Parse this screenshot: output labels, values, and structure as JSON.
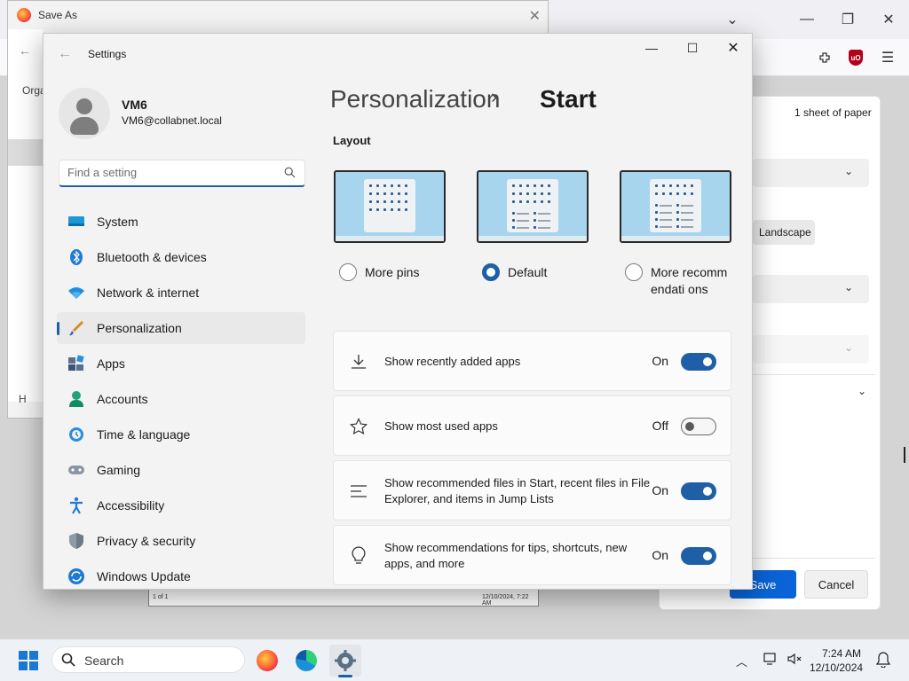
{
  "browser": {
    "save_as_title": "Save As",
    "save_as_org": "Orga",
    "save_as_h": "H"
  },
  "print": {
    "sheets": "1 sheet of paper",
    "landscape": "Landscape",
    "save": "Save",
    "cancel": "Cancel",
    "preview_left": "1 of 1",
    "preview_right": "12/10/2024, 7:22 AM"
  },
  "settings": {
    "app_title": "Settings",
    "user_name": "VM6",
    "user_email": "VM6@collabnet.local",
    "search_placeholder": "Find a setting",
    "nav": [
      {
        "label": "System",
        "icon": "system-icon"
      },
      {
        "label": "Bluetooth & devices",
        "icon": "bluetooth-icon"
      },
      {
        "label": "Network & internet",
        "icon": "wifi-icon"
      },
      {
        "label": "Personalization",
        "icon": "brush-icon",
        "active": true
      },
      {
        "label": "Apps",
        "icon": "apps-icon"
      },
      {
        "label": "Accounts",
        "icon": "accounts-icon"
      },
      {
        "label": "Time & language",
        "icon": "clock-globe-icon"
      },
      {
        "label": "Gaming",
        "icon": "gamepad-icon"
      },
      {
        "label": "Accessibility",
        "icon": "accessibility-icon"
      },
      {
        "label": "Privacy & security",
        "icon": "shield-icon"
      },
      {
        "label": "Windows Update",
        "icon": "update-icon"
      }
    ],
    "breadcrumb_parent": "Personalization",
    "breadcrumb_sep": "›",
    "breadcrumb_current": "Start",
    "layout_label": "Layout",
    "layout_options": [
      {
        "label": "More pins",
        "selected": false
      },
      {
        "label": "Default",
        "selected": true
      },
      {
        "label": "More recommendati ons",
        "selected": false
      }
    ],
    "toggles": [
      {
        "text": "Show recently added apps",
        "state": "On",
        "on": true,
        "icon": "download-icon"
      },
      {
        "text": "Show most used apps",
        "state": "Off",
        "on": false,
        "icon": "star-icon"
      },
      {
        "text": "Show recommended files in Start, recent files in File Explorer, and items in Jump Lists",
        "state": "On",
        "on": true,
        "icon": "list-icon"
      },
      {
        "text": "Show recommendations for tips, shortcuts, new apps, and more",
        "state": "On",
        "on": true,
        "icon": "lightbulb-icon"
      }
    ]
  },
  "taskbar": {
    "search_label": "Search",
    "time": "7:24 AM",
    "date": "12/10/2024"
  },
  "colors": {
    "accent": "#1f5fa6",
    "save_button": "#0a64d8"
  }
}
